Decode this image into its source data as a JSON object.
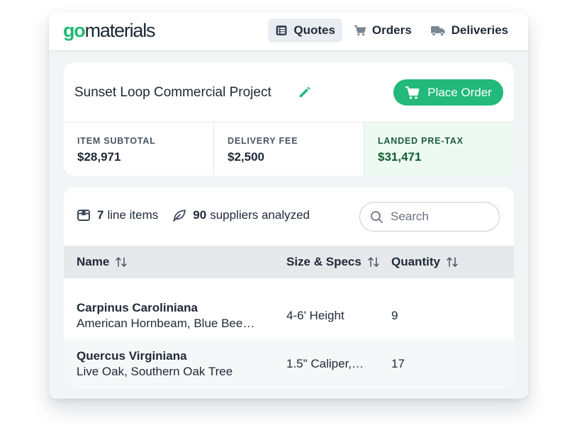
{
  "brand": {
    "logo_go": "go",
    "logo_rest": "materials",
    "accent": "#22b97a"
  },
  "nav": [
    {
      "label": "Quotes",
      "icon": "list-icon",
      "active": true
    },
    {
      "label": "Orders",
      "icon": "cart-icon",
      "active": false
    },
    {
      "label": "Deliveries",
      "icon": "truck-icon",
      "active": false
    }
  ],
  "project": {
    "title": "Sunset Loop Commercial Project",
    "place_order_label": "Place Order"
  },
  "stats": [
    {
      "label": "ITEM SUBTOTAL",
      "value": "$28,971"
    },
    {
      "label": "DELIVERY FEE",
      "value": "$2,500"
    },
    {
      "label": "LANDED PRE-TAX",
      "value": "$31,471"
    }
  ],
  "summary": {
    "line_items_count": "7",
    "line_items_text": "line items",
    "suppliers_count": "90",
    "suppliers_text": "suppliers analyzed"
  },
  "search": {
    "placeholder": "Search"
  },
  "table": {
    "columns": [
      "Name",
      "Size & Specs",
      "Quantity"
    ],
    "rows": [
      {
        "name": "Carpinus Caroliniana",
        "common": "American Hornbeam, Blue Bee…",
        "size": "4-6' Height",
        "qty": "9"
      },
      {
        "name": "Quercus Virginiana",
        "common": "Live Oak, Southern Oak Tree",
        "size": "1.5\" Caliper,…",
        "qty": "17"
      }
    ]
  }
}
